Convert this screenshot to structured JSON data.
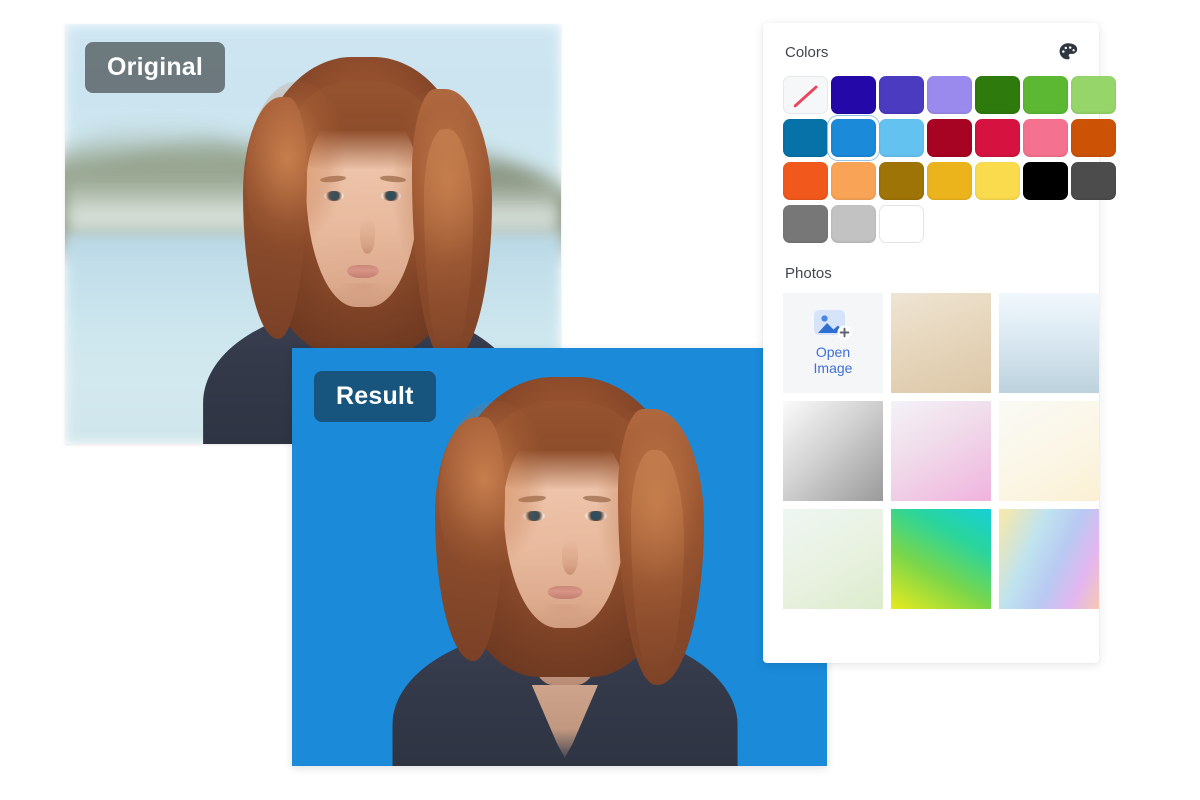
{
  "app": {
    "background": "#ffffff"
  },
  "canvas": {
    "original": {
      "badge_label": "Original",
      "badge_bg": "#5c666a",
      "description": "Portrait of a young woman with auburn bob hair in a navy t-shirt, blurred lake and hills background"
    },
    "result": {
      "badge_label": "Result",
      "badge_bg": "#17557f",
      "background_color": "#1a8ad9",
      "description": "Same portrait with the background removed and replaced by solid blue"
    }
  },
  "panel": {
    "colors": {
      "title": "Colors",
      "icon": "palette-icon",
      "selected_index": 8,
      "swatches": [
        {
          "name": "transparent",
          "hex": "none"
        },
        {
          "name": "indigo",
          "hex": "#2409a8"
        },
        {
          "name": "violet-blue",
          "hex": "#4a3bc0"
        },
        {
          "name": "light-purple",
          "hex": "#9b8aee"
        },
        {
          "name": "dark-green",
          "hex": "#2f7a0c"
        },
        {
          "name": "green",
          "hex": "#5cb832"
        },
        {
          "name": "light-green",
          "hex": "#95d56a"
        },
        {
          "name": "deep-blue",
          "hex": "#0672a8"
        },
        {
          "name": "blue",
          "hex": "#1a8ad9"
        },
        {
          "name": "sky-blue",
          "hex": "#64c2f0"
        },
        {
          "name": "dark-red",
          "hex": "#a70322"
        },
        {
          "name": "crimson",
          "hex": "#d51240"
        },
        {
          "name": "pink",
          "hex": "#f4718f"
        },
        {
          "name": "burnt-orange",
          "hex": "#cc5206"
        },
        {
          "name": "orange",
          "hex": "#f0591b"
        },
        {
          "name": "light-orange",
          "hex": "#f8a355"
        },
        {
          "name": "olive",
          "hex": "#9e7406"
        },
        {
          "name": "gold",
          "hex": "#ecb41c"
        },
        {
          "name": "yellow",
          "hex": "#fadb4e"
        },
        {
          "name": "black",
          "hex": "#000000"
        },
        {
          "name": "dark-gray",
          "hex": "#4c4c4c"
        },
        {
          "name": "gray",
          "hex": "#777777"
        },
        {
          "name": "light-gray",
          "hex": "#c2c2c2"
        },
        {
          "name": "white",
          "hex": "#ffffff"
        }
      ]
    },
    "photos": {
      "title": "Photos",
      "open_image": {
        "label_line1": "Open",
        "label_line2": "Image",
        "icon": "add-image-icon",
        "text_color": "#3f6fd8"
      },
      "tiles": [
        {
          "name": "beige-gradient",
          "css": "linear-gradient(160deg,#efe5d4 0%,#e6d6bc 48%,#dcc7a8 100%)"
        },
        {
          "name": "blue-white-gradient",
          "css": "linear-gradient(180deg,#f2f8fc 0%,#dbe9f2 45%,#bdd2dd 100%)"
        },
        {
          "name": "gray-gradient",
          "css": "linear-gradient(135deg,#fbfbfb 0%,#d2d2d2 45%,#9a9a9a 100%)"
        },
        {
          "name": "pink-gradient",
          "css": "linear-gradient(150deg,#f4f2f8 0%,#f0dcea 42%,#f0b3de 100%)"
        },
        {
          "name": "cream-gradient",
          "css": "linear-gradient(150deg,#fafaf5 0%,#fbf6e6 55%,#fbf0d4 100%)"
        },
        {
          "name": "mint-gradient",
          "css": "linear-gradient(150deg,#eef6f2 0%,#e9f2e2 50%,#dceccd 100%)"
        },
        {
          "name": "green-cyan-gradient",
          "css": "linear-gradient(30deg,#e9ea1e 0%,#7ad64a 38%,#2bd59b 70%,#16cfd8 100%)"
        },
        {
          "name": "rainbow-gradient",
          "css": "linear-gradient(115deg,#fbe9a6 0%,#bfe3ef 34%,#b9c9f2 58%,#e4b6ef 80%,#f5c9b2 100%)"
        }
      ]
    }
  }
}
